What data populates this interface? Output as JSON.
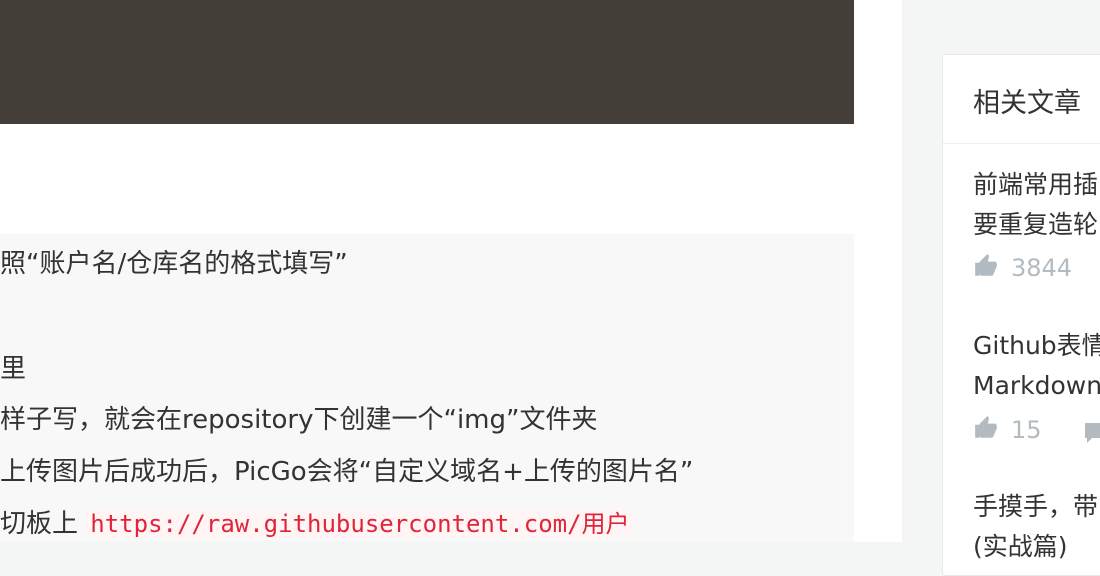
{
  "quote_lines": [
    "照“账户名/仓库名的格式填写”",
    "里",
    "样子写，就会在repository下创建一个“img”文件夹",
    "上传图片后成功后，PicGo会将“自定义域名+上传的图片名”",
    "切板上"
  ],
  "quote_code": "https://raw.githubusercontent.com/用户",
  "sidebar": {
    "title": "相关文章",
    "articles": [
      {
        "line1": "前端常用插",
        "line2": "要重复造轮",
        "likes": "3844"
      },
      {
        "line1": "Github表情",
        "line2": "Markdown",
        "likes": "15"
      },
      {
        "line1": "手摸手，带",
        "line2": "(实战篇)",
        "likes": ""
      }
    ]
  }
}
